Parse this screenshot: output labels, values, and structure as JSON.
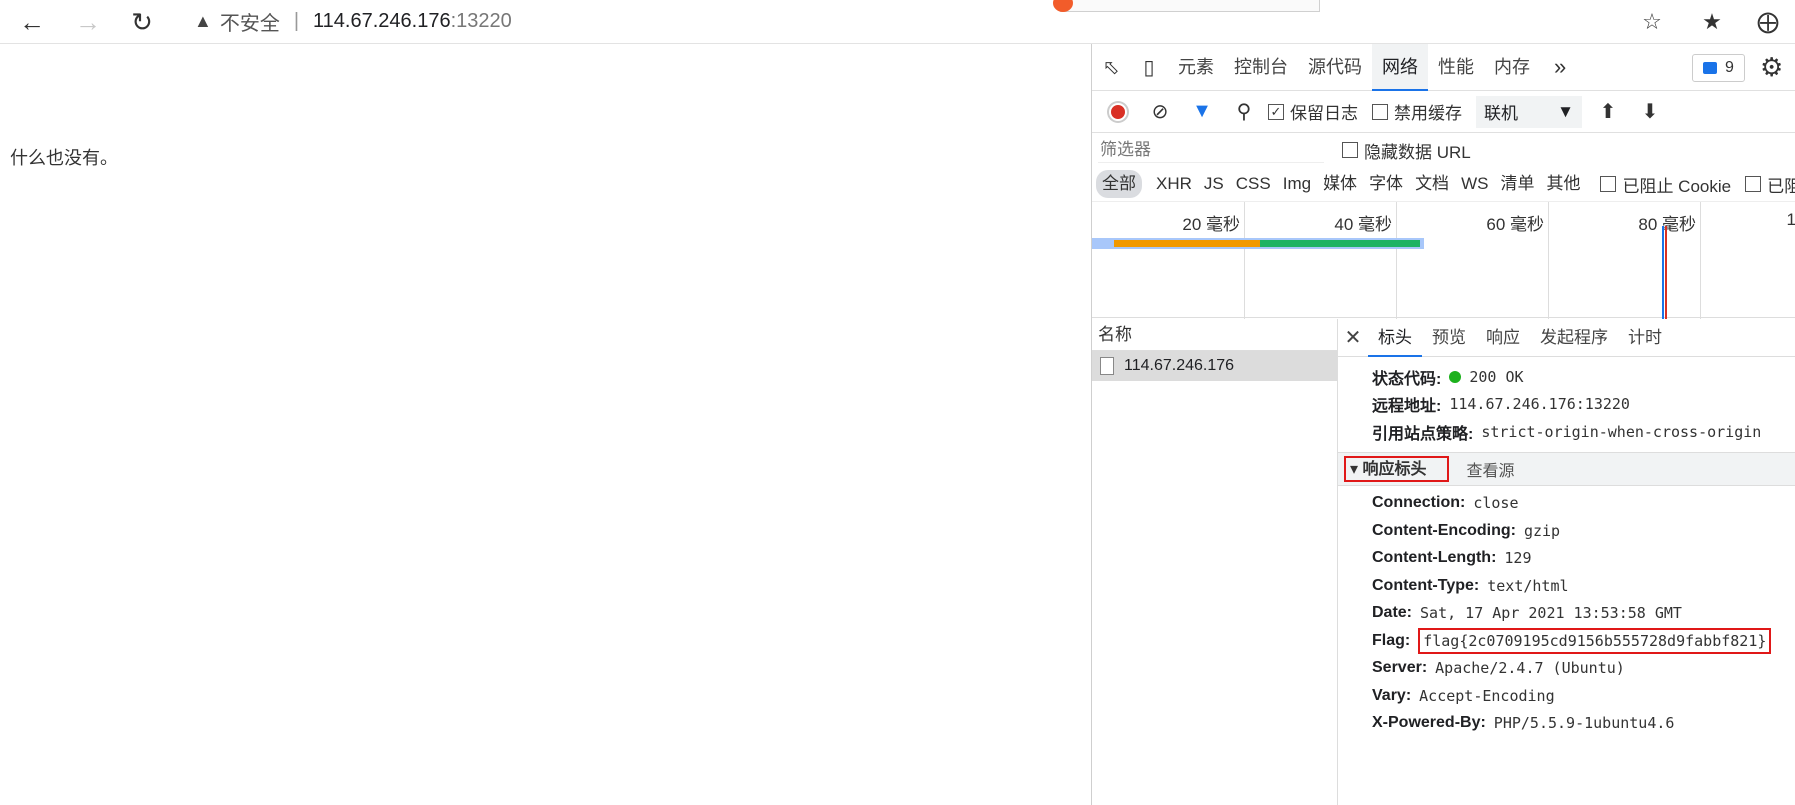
{
  "browser": {
    "address": {
      "security_label": "不安全",
      "separator": "|",
      "host": "114.67.246.176",
      "port": ":13220"
    }
  },
  "page": {
    "message": "什么也没有。"
  },
  "devtools": {
    "tabs": [
      "元素",
      "控制台",
      "源代码",
      "网络",
      "性能",
      "内存"
    ],
    "active_tab": "网络",
    "message_count": "9",
    "toolbar": {
      "preserve_log": "保留日志",
      "disable_cache": "禁用缓存",
      "throttle": "联机"
    },
    "filter": {
      "placeholder": "筛选器",
      "hide_data_url": "隐藏数据 URL"
    },
    "types": [
      "全部",
      "XHR",
      "JS",
      "CSS",
      "Img",
      "媒体",
      "字体",
      "文档",
      "WS",
      "清单",
      "其他"
    ],
    "blocked_cookies": "已阻止 Cookie",
    "blocked_requests": "已阻",
    "timeline_labels": [
      "20 毫秒",
      "40 毫秒",
      "60 毫秒",
      "80 毫秒",
      "1"
    ],
    "names_header": "名称",
    "request_name": "114.67.246.176",
    "detail_tabs": [
      "标头",
      "预览",
      "响应",
      "发起程序",
      "计时"
    ],
    "active_detail_tab": "标头",
    "general": [
      {
        "key": "状态代码:",
        "value": "200 OK"
      },
      {
        "key": "远程地址:",
        "value": "114.67.246.176:13220"
      },
      {
        "key": "引用站点策略:",
        "value": "strict-origin-when-cross-origin"
      }
    ],
    "response_headers_title": "响应标头",
    "view_source": "查看源",
    "response_headers": [
      {
        "key": "Connection:",
        "value": "close"
      },
      {
        "key": "Content-Encoding:",
        "value": "gzip"
      },
      {
        "key": "Content-Length:",
        "value": "129"
      },
      {
        "key": "Content-Type:",
        "value": "text/html"
      },
      {
        "key": "Date:",
        "value": "Sat, 17 Apr 2021 13:53:58 GMT"
      },
      {
        "key": "Flag:",
        "value": "flag{2c0709195cd9156b555728d9fabbf821}"
      },
      {
        "key": "Server:",
        "value": "Apache/2.4.7 (Ubuntu)"
      },
      {
        "key": "Vary:",
        "value": "Accept-Encoding"
      },
      {
        "key": "X-Powered-By:",
        "value": "PHP/5.5.9-1ubuntu4.6"
      }
    ]
  },
  "colors": {
    "accent": "#1a73e8",
    "highlight_box": "#e01818",
    "status_ok": "#1db11d",
    "record": "#d93025"
  }
}
